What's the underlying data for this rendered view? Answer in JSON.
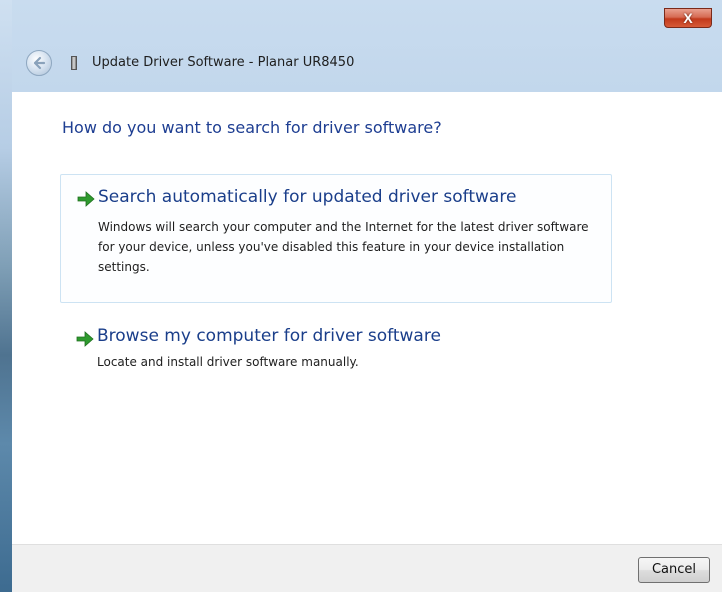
{
  "window": {
    "title": "Update Driver Software - Planar UR8450",
    "close_label": "X"
  },
  "icons": {
    "back": "back-arrow-icon",
    "device": "device-icon",
    "option_arrow": "green-arrow-icon"
  },
  "colors": {
    "heading": "#1e3e92",
    "option_title": "#1a3e8a",
    "arrow_green": "#2e9a2e",
    "selected_border": "#cde3f3"
  },
  "main": {
    "heading": "How do you want to search for driver software?",
    "options": [
      {
        "title": "Search automatically for updated driver software",
        "description": "Windows will search your computer and the Internet for the latest driver software for your device, unless you've disabled this feature in your device installation settings."
      },
      {
        "title": "Browse my computer for driver software",
        "description": "Locate and install driver software manually."
      }
    ]
  },
  "footer": {
    "cancel_label": "Cancel"
  }
}
